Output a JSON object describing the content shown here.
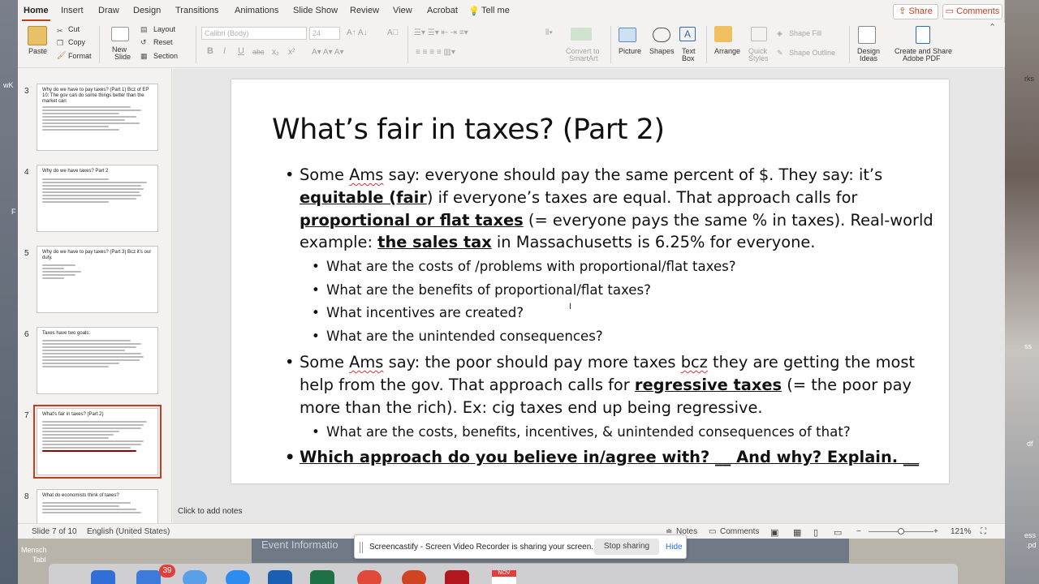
{
  "desktop": {
    "left_labels": [
      "wK",
      "F",
      "Mensch",
      "Tabl"
    ],
    "right_labels": [
      "rks",
      "ss",
      "df",
      "ess",
      ".pd"
    ],
    "dock_badge": "39",
    "dock_cal": "NOV",
    "bg_text": "Event Informatio"
  },
  "tabs": [
    "Home",
    "Insert",
    "Draw",
    "Design",
    "Transitions",
    "Animations",
    "Slide Show",
    "Review",
    "View",
    "Acrobat",
    "Tell me"
  ],
  "share_label": "Share",
  "comments_label": "Comments",
  "ribbon": {
    "paste": "Paste",
    "cut": "Cut",
    "copy": "Copy",
    "format": "Format",
    "new_slide": [
      "New",
      "Slide"
    ],
    "layout": "Layout",
    "reset": "Reset",
    "section": "Section",
    "font_name": "Calibri (Body)",
    "font_size": "24",
    "convert": [
      "Convert to",
      "SmartArt"
    ],
    "picture": "Picture",
    "shapes": "Shapes",
    "textbox": [
      "Text",
      "Box"
    ],
    "arrange": "Arrange",
    "quick_styles": [
      "Quick",
      "Styles"
    ],
    "shape_fill": "Shape Fill",
    "shape_outline": "Shape Outline",
    "design_ideas": [
      "Design",
      "Ideas"
    ],
    "create_share": [
      "Create and Share",
      "Adobe PDF"
    ],
    "bold": "B",
    "italic": "I",
    "underline": "U",
    "strike": "abc",
    "sub": "x₂",
    "sup": "x²"
  },
  "thumbnails": [
    {
      "num": "3",
      "title": "Why do we have to pay taxes? (Part 1) Bcz of EP 10: The gov can do some things better than the market can",
      "lines": 11
    },
    {
      "num": "4",
      "title": "Why do we have taxes? Part 2",
      "lines": 12
    },
    {
      "num": "5",
      "title": "Why do we have to pay taxes? (Part 3) Bcz it's our duty.",
      "lines": 6
    },
    {
      "num": "6",
      "title": "Taxes have two goals:",
      "lines": 11
    },
    {
      "num": "7",
      "title": "What's fair in taxes? (Part 2)",
      "lines": 12
    },
    {
      "num": "8",
      "title": "What do economists think of taxes?",
      "lines": 8
    }
  ],
  "slide": {
    "title": "What’s fair in taxes? (Part 2)",
    "p1": {
      "t1": "Some ",
      "ams": "Ams",
      "t2": " say: everyone should pay the same percent of $. They say: it’s ",
      "u1": "equitable (fair",
      "t3": ") if everyone’s taxes are equal. That approach calls for ",
      "u2": "proportional or flat taxes",
      "t4": " (= everyone pays the same % in taxes). Real-world example: ",
      "u3": "the sales tax",
      "t5": " in Massachusetts is 6.25% for everyone."
    },
    "sub1": [
      "What are the costs of /problems with proportional/flat taxes?",
      "What are the benefits of proportional/flat taxes?",
      "What incentives are created?",
      "What are the unintended consequences?"
    ],
    "p2": {
      "t1": "Some ",
      "ams": "Ams",
      "t2": " say: the poor should pay more taxes ",
      "bcz": "bcz",
      "t3": " they are getting the most help from the gov. That approach calls for ",
      "u1": "regressive taxes",
      "t4": " (= the poor pay more than the rich). Ex: cig taxes end up being regressive."
    },
    "sub2": [
      "What are the costs, benefits, incentives, & unintended consequences of that?"
    ],
    "p3": "Which approach do you believe in/agree with? __ And why? Explain. __"
  },
  "notes_placeholder": "Click to add notes",
  "status": {
    "slide_of": "Slide 7 of 10",
    "language": "English (United States)",
    "notes": "Notes",
    "comments": "Comments",
    "zoom": "121%"
  },
  "castify": {
    "message": "Screencastify - Screen Video Recorder is sharing your screen.",
    "stop": "Stop sharing",
    "hide": "Hide"
  }
}
